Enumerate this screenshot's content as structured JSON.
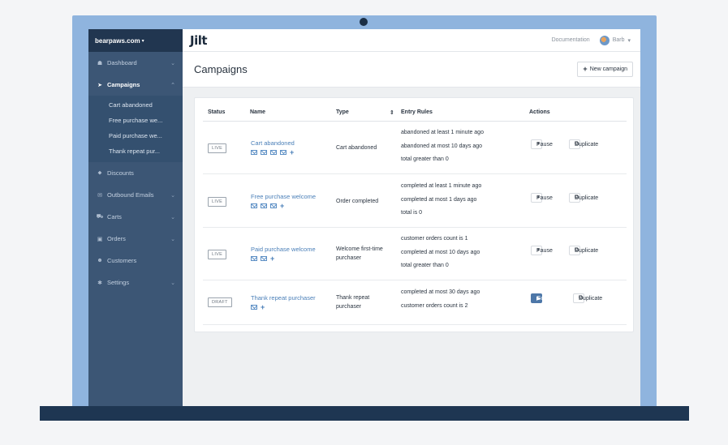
{
  "sidebar": {
    "account": "bearpaws.com",
    "items": [
      {
        "label": "Dashboard",
        "icon": "dashboard-icon",
        "glyph": "☗",
        "chev": "⌄"
      },
      {
        "label": "Campaigns",
        "icon": "paper-plane-icon",
        "glyph": "➤",
        "chev": "⌃"
      },
      {
        "label": "Discounts",
        "icon": "tag-icon",
        "glyph": "⬥",
        "chev": ""
      },
      {
        "label": "Outbound Emails",
        "icon": "envelope-icon",
        "glyph": "✉",
        "chev": "⌄"
      },
      {
        "label": "Carts",
        "icon": "cart-icon",
        "glyph": "⛟",
        "chev": "⌄"
      },
      {
        "label": "Orders",
        "icon": "money-icon",
        "glyph": "▣",
        "chev": "⌄"
      },
      {
        "label": "Customers",
        "icon": "users-icon",
        "glyph": "☻",
        "chev": ""
      },
      {
        "label": "Settings",
        "icon": "gear-icon",
        "glyph": "✱",
        "chev": "⌄"
      }
    ],
    "sub_items": [
      "Cart abandoned",
      "Free purchase we...",
      "Paid purchase we...",
      "Thank repeat pur..."
    ]
  },
  "topbar": {
    "logo": "Jilt",
    "documentation": "Documentation",
    "user": "Barb"
  },
  "header": {
    "title": "Campaigns",
    "new_button": "New campaign"
  },
  "table": {
    "columns": {
      "status": "Status",
      "name": "Name",
      "type": "Type",
      "rules": "Entry Rules",
      "actions": "Actions"
    },
    "rows": [
      {
        "status": "LIVE",
        "name": "Cart abandoned",
        "emails": 4,
        "type": "Cart abandoned",
        "rules": [
          "abandoned at least 1 minute ago",
          "abandoned at most 10 days ago",
          "total greater than 0"
        ],
        "primary_action": "Pause",
        "secondary_action": "Duplicate"
      },
      {
        "status": "LIVE",
        "name": "Free purchase welcome",
        "emails": 3,
        "type": "Order completed",
        "rules": [
          "completed at least 1 minute ago",
          "completed at most 1 days ago",
          "total is 0"
        ],
        "primary_action": "Pause",
        "secondary_action": "Duplicate"
      },
      {
        "status": "LIVE",
        "name": "Paid purchase welcome",
        "emails": 2,
        "type": "Welcome first-time purchaser",
        "rules": [
          "customer orders count is 1",
          "completed at most 10 days ago",
          "total greater than 0"
        ],
        "primary_action": "Pause",
        "secondary_action": "Duplicate"
      },
      {
        "status": "DRAFT",
        "name": "Thank repeat purchaser",
        "emails": 1,
        "type": "Thank repeat purchaser",
        "rules": [
          "completed at most 30 days ago",
          "customer orders count is 2"
        ],
        "primary_action": "Go Live",
        "secondary_action": "Duplicate"
      }
    ]
  },
  "colors": {
    "sidebar": "#3c5675",
    "accent": "#4a7fb8",
    "primary_button": "#4d77a8"
  }
}
